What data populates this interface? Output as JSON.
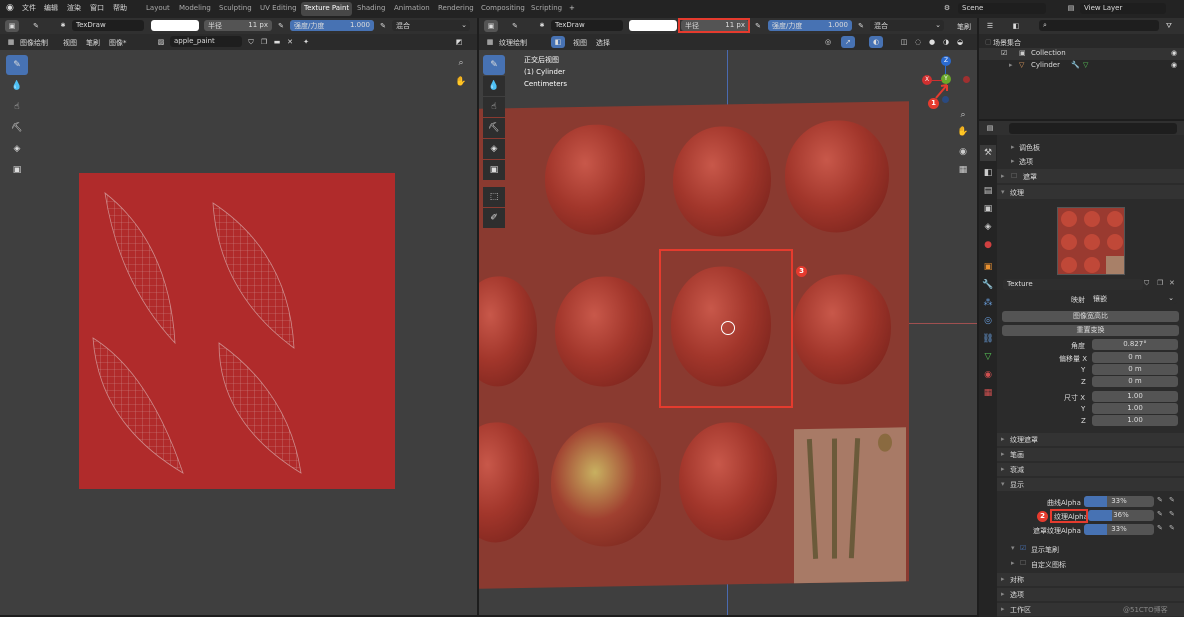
{
  "menu": {
    "file": "文件",
    "edit": "编辑",
    "render": "渲染",
    "window": "窗口",
    "help": "帮助"
  },
  "workspaces": [
    "Layout",
    "Modeling",
    "Sculpting",
    "UV Editing",
    "Texture Paint",
    "Shading",
    "Animation",
    "Rendering",
    "Compositing",
    "Scripting"
  ],
  "workspaces_active": "Texture Paint",
  "add_tab": "+",
  "scene": {
    "name": "Scene",
    "view_layer": "View Layer"
  },
  "left": {
    "brush_name": "TexDraw",
    "radius_label": "半径",
    "radius_value": "11 px",
    "strength_label": "强度/力度",
    "strength_value": "1.000",
    "strength_fraction": 1.0,
    "blend": "混合",
    "mode": "图像绘制",
    "menus": [
      "视图",
      "笔刷",
      "图像*"
    ],
    "image_name": "apple_paint"
  },
  "right": {
    "brush_name": "TexDraw",
    "radius_label": "半径",
    "radius_value": "11 px",
    "strength_label": "强度/力度",
    "strength_value": "1.000",
    "strength_fraction": 1.0,
    "blend": "混合",
    "brush_menu": "笔刷",
    "mode": "纹理绘制",
    "menus": [
      "视图",
      "选择"
    ],
    "overlay_lines": [
      "正交后视图",
      "(1) Cylinder",
      "Centimeters"
    ]
  },
  "axes": {
    "x": "X",
    "y": "Y",
    "z": "Z"
  },
  "outliner": {
    "root": "场景集合",
    "collection": "Collection",
    "object": "Cylinder"
  },
  "properties": {
    "palette": "调色板",
    "options_top": "选项",
    "mask": "遮罩",
    "texture_section": "纹理",
    "texture_name": "Texture",
    "mapping_label": "映射",
    "mapping_value": "镶嵌",
    "aspect_btn": "图像宽高比",
    "reset_btn": "重置变换",
    "angle_label": "角度",
    "angle_value": "0.827°",
    "offset_x_label": "偏移量 X",
    "offset_x": "0 m",
    "offset_y_label": "Y",
    "offset_y": "0 m",
    "offset_z_label": "Z",
    "offset_z": "0 m",
    "size_x_label": "尺寸 X",
    "size_x": "1.00",
    "size_y_label": "Y",
    "size_y": "1.00",
    "size_z_label": "Z",
    "size_z": "1.00",
    "tex_mask": "纹理遮罩",
    "stroke": "笔画",
    "falloff": "衰减",
    "display": "显示",
    "curve_alpha_label": "曲线Alpha",
    "curve_alpha": "33%",
    "curve_alpha_fraction": 0.33,
    "tex_alpha_label": "纹理Alpha",
    "tex_alpha": "36%",
    "tex_alpha_fraction": 0.36,
    "mask_alpha_label": "遮罩纹理Alpha",
    "mask_alpha": "33%",
    "mask_alpha_fraction": 0.33,
    "show_brush": "显示笔刷",
    "custom_icon": "自定义图标",
    "symmetry": "对称",
    "options": "选项",
    "workspace": "工作区"
  },
  "badges": [
    "1",
    "2",
    "3",
    "4"
  ],
  "watermark": "@51CTO博客",
  "colors": {
    "accent": "#4772b3",
    "annotation": "#e53b2e",
    "uv_bg": "#b02b2b",
    "header": "#303030"
  }
}
